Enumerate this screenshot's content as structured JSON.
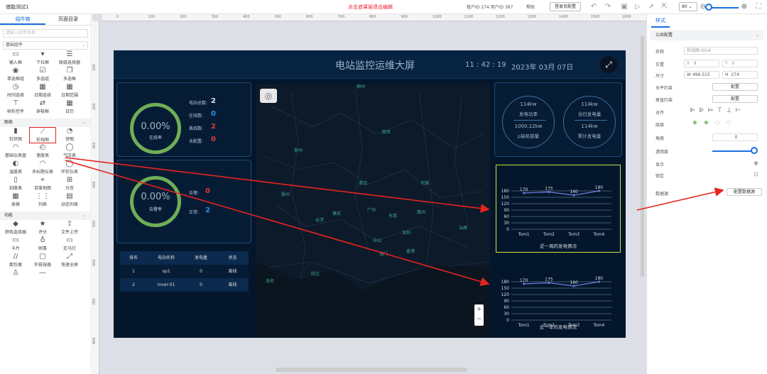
{
  "topbar": {
    "title": "储能测试1",
    "notice": "点击遮罩层退出编辑",
    "ids": "租户ID 274 用户ID 387",
    "help": "帮助",
    "login_btn": "登录页配置",
    "zoom_value": "80"
  },
  "left": {
    "tabs": [
      "组件箱",
      "页面目录"
    ],
    "search_placeholder": "请输入组件名称",
    "select_value": "基础组件",
    "basic_items": [
      {
        "label": "输入框",
        "icon": "▭"
      },
      {
        "label": "下拉框",
        "icon": "▾"
      },
      {
        "label": "联级选择器",
        "icon": "☰"
      },
      {
        "label": "单选框组",
        "icon": "◉"
      },
      {
        "label": "多选组",
        "icon": "☑"
      },
      {
        "label": "多选框",
        "icon": "❐"
      },
      {
        "label": "时间选择",
        "icon": "◷"
      },
      {
        "label": "日期选择",
        "icon": "▦"
      },
      {
        "label": "日期范围",
        "icon": "▦"
      },
      {
        "label": "树形控件",
        "icon": "⊤"
      },
      {
        "label": "穿梭框",
        "icon": "⇄"
      },
      {
        "label": "日历",
        "icon": "▦"
      }
    ],
    "chart_section": "图表",
    "chart_items": [
      {
        "label": "柱状图",
        "icon": "▮"
      },
      {
        "label": "折线图",
        "icon": "⟋"
      },
      {
        "label": "饼图",
        "icon": "◔"
      },
      {
        "label": "基础仪表盘",
        "icon": "◠"
      },
      {
        "label": "速度表",
        "icon": "◴"
      },
      {
        "label": "气压表",
        "icon": "◯"
      },
      {
        "label": "温度表",
        "icon": "◐"
      },
      {
        "label": "多标题仪表",
        "icon": "◠"
      },
      {
        "label": "环形仪表",
        "icon": "◯"
      },
      {
        "label": "刻度表",
        "icon": "▯"
      },
      {
        "label": "百度地图",
        "icon": "⌖"
      },
      {
        "label": "分页",
        "icon": "⊞"
      },
      {
        "label": "表格",
        "icon": "▦"
      },
      {
        "label": "列表",
        "icon": "⋮⋮"
      },
      {
        "label": "动态列表",
        "icon": "▤"
      }
    ],
    "func_section": "功能",
    "func_items": [
      {
        "label": "颜色选择器",
        "icon": "◆"
      },
      {
        "label": "评分",
        "icon": "★"
      },
      {
        "label": "文件上传",
        "icon": "⇪"
      },
      {
        "label": "卡片",
        "icon": "▭"
      },
      {
        "label": "刷事",
        "icon": "♁"
      },
      {
        "label": "走马灯",
        "icon": "▭"
      },
      {
        "label": "面包屑",
        "icon": "//"
      },
      {
        "label": "外链容器",
        "icon": "▢"
      },
      {
        "label": "快速全屏",
        "icon": "⤢"
      },
      {
        "label": "",
        "icon": "♙"
      },
      {
        "label": "",
        "icon": "—"
      }
    ]
  },
  "ruler": {
    "h": [
      "0",
      "100",
      "200",
      "300",
      "400",
      "500",
      "600",
      "700",
      "800",
      "900",
      "1000",
      "1100",
      "1200",
      "1300",
      "1400",
      "1500",
      "1600",
      "1700",
      "1800"
    ],
    "v": [
      "100",
      "200",
      "300",
      "400",
      "500",
      "600",
      "700",
      "800"
    ]
  },
  "screen": {
    "title": "电站监控运维大屏",
    "time": "11 : 42 : 19",
    "date": "2023年 03月 07日",
    "ring1": {
      "value": "0.00%",
      "label": "在线率"
    },
    "stats1": [
      {
        "label": "电站总数:",
        "value": "2",
        "color": "#d9e3ec"
      },
      {
        "label": "在线数:",
        "value": "0",
        "color": "#2a8fe0"
      },
      {
        "label": "离线数:",
        "value": "2",
        "color": "#e03a3a"
      },
      {
        "label": "未配置:",
        "value": "0",
        "color": "#e03a3a"
      }
    ],
    "ring2": {
      "value": "0.00%",
      "label": "告警率"
    },
    "stats2": [
      {
        "label": "告警:",
        "value": "0",
        "color": "#e03a3a"
      },
      {
        "label": "正常:",
        "value": "2",
        "color": "#2a8fe0"
      }
    ],
    "table": {
      "headers": [
        "排名",
        "电站名称",
        "发电量",
        "状态"
      ],
      "rows": [
        [
          "1",
          "op1",
          "0",
          "离线"
        ],
        [
          "2",
          "inver-01",
          "0",
          "离线"
        ]
      ]
    },
    "map_cities": [
      {
        "name": "柳州"
      },
      {
        "name": "韶关"
      },
      {
        "name": "贺州"
      },
      {
        "name": "清远"
      },
      {
        "name": "河源"
      },
      {
        "name": "梧州"
      },
      {
        "name": "肇庆"
      },
      {
        "name": "广州"
      },
      {
        "name": "东莞"
      },
      {
        "name": "惠州"
      },
      {
        "name": "云浮"
      },
      {
        "name": "汕尾"
      },
      {
        "name": "深圳"
      },
      {
        "name": "中山"
      },
      {
        "name": "香港"
      },
      {
        "name": "澳门"
      },
      {
        "name": "阳江"
      },
      {
        "name": "茂名"
      }
    ],
    "circles": [
      {
        "top": "114kw",
        "mid": "发电功率",
        "v2": "1000.12kw",
        "l2": "p装机容量"
      },
      {
        "top": "114kw",
        "mid": "当日发电量",
        "v2": "114kw",
        "l2": "累计发电量"
      }
    ]
  },
  "chart_data": [
    {
      "type": "line",
      "title": "近一周的发电情况",
      "categories": [
        "Tom1",
        "Tom2",
        "Tom3",
        "Tom4"
      ],
      "values": [
        170,
        175,
        160,
        180
      ],
      "yticks": [
        0,
        30,
        60,
        90,
        120,
        150,
        180
      ],
      "ylim": [
        0,
        180
      ],
      "color": "#6d7fe0"
    },
    {
      "type": "line",
      "title": "近一年的发电情况",
      "categories": [
        "Tom1",
        "Tom2",
        "Tom3",
        "Tom4"
      ],
      "values": [
        170,
        175,
        160,
        180
      ],
      "yticks": [
        0,
        30,
        60,
        90,
        120,
        150,
        180
      ],
      "ylim": [
        0,
        180
      ],
      "color": "#6d7fe0"
    }
  ],
  "right": {
    "tab": "样式",
    "section": "公共配置",
    "name_label": "名称",
    "name_value": "折线图-XG4l",
    "pos_label": "位置",
    "x_label": "X",
    "x_value": "8",
    "y_label": "Y",
    "y_value": "0",
    "size_label": "尺寸",
    "w_label": "W",
    "w_value": "496.515",
    "h_label": "H",
    "h_value": "274",
    "hcon_label": "水平约束",
    "config_btn": "配置",
    "vcon_label": "垂直约束",
    "align_label": "对齐",
    "layer_label": "层级",
    "angle_label": "角度",
    "angle_value": "0",
    "opacity_label": "透明度",
    "display_label": "显示",
    "lock_label": "锁定",
    "ds_label": "数据源",
    "ds_btn": "配置数据源"
  }
}
